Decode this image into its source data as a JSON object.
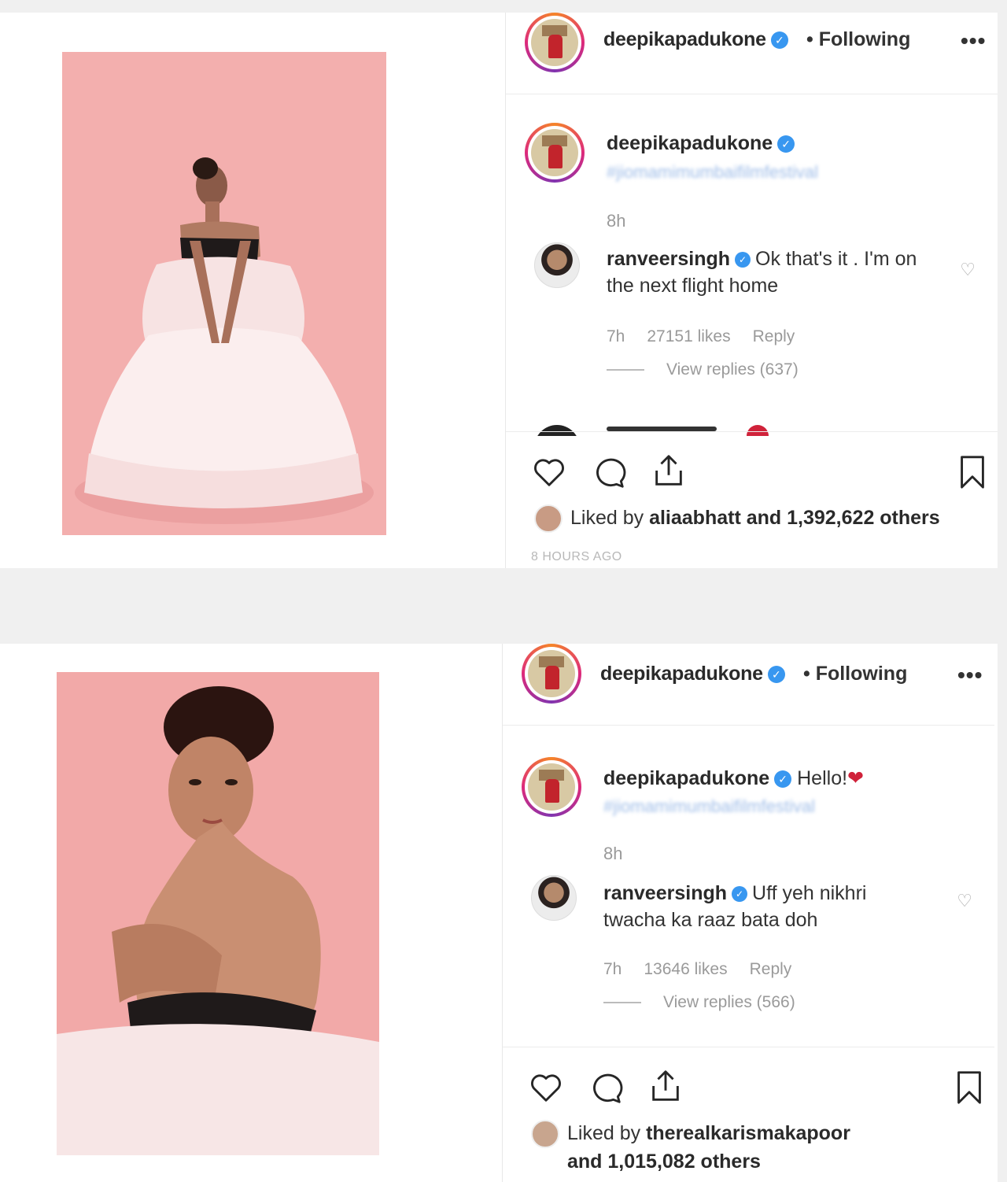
{
  "posts": [
    {
      "header": {
        "username": "deepikapadukone",
        "following_label": "• Following",
        "more_label": "•••"
      },
      "caption": {
        "username": "deepikapadukone",
        "text": "",
        "hashtag": "#jiomamimumbaifilmfestival",
        "time": "8h"
      },
      "comment": {
        "username": "ranveersingh",
        "text": "Ok that's it . I'm on the next flight home",
        "time": "7h",
        "likes": "27151 likes",
        "reply_label": "Reply",
        "view_replies": "View replies (637)"
      },
      "likes": {
        "prefix": "Liked by",
        "liker": "aliaabhatt",
        "suffix": "and 1,392,622 others"
      },
      "posted_ago": "8 HOURS AGO"
    },
    {
      "header": {
        "username": "deepikapadukone",
        "following_label": "• Following",
        "more_label": "•••"
      },
      "caption": {
        "username": "deepikapadukone",
        "text": "Hello!",
        "hashtag": "#jiomamimumbaifilmfestival",
        "time": "8h"
      },
      "comment": {
        "username": "ranveersingh",
        "text": "Uff yeh nikhri twacha ka raaz bata doh",
        "time": "7h",
        "likes": "13646 likes",
        "reply_label": "Reply",
        "view_replies": "View replies (566)"
      },
      "likes": {
        "prefix": "Liked by",
        "liker": "therealkarismakapoor",
        "suffix": "and 1,015,082 others"
      }
    }
  ],
  "icons": {
    "verified": "verified-badge-icon",
    "heart": "heart-icon",
    "comment": "comment-icon",
    "share": "share-icon",
    "bookmark": "bookmark-icon",
    "red_heart": "red-heart-emoji-icon"
  },
  "colors": {
    "verified_blue": "#3897f0",
    "photo_pink": "#f2aaa9",
    "text_dark": "#262626",
    "text_muted": "#9a9a9a"
  }
}
